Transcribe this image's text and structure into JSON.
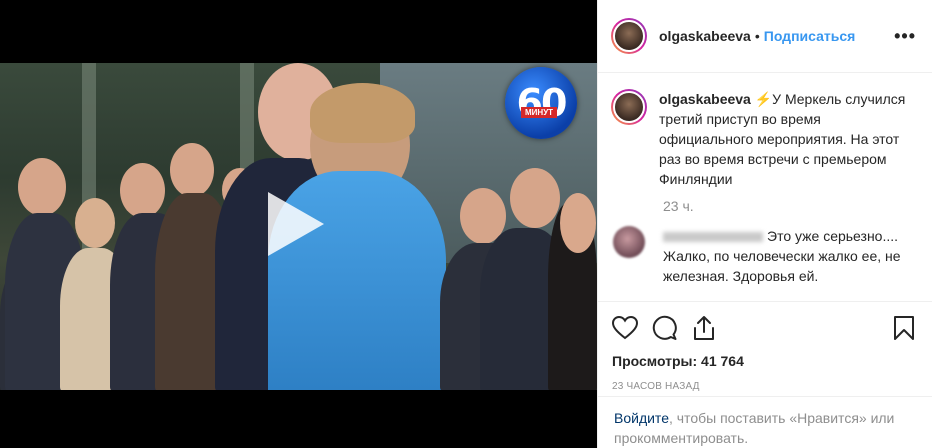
{
  "post": {
    "username": "olgaskabeeva",
    "separator": "•",
    "follow_label": "Подписаться",
    "more_label": "•••"
  },
  "caption": {
    "username": "olgaskabeeva",
    "emoji": "⚡",
    "text": "У Меркель случился третий приступ во время официального мероприятия. На этот раз во время встречи с премьером Финляндии",
    "time": "23 ч."
  },
  "comment": {
    "text": "Это уже серьезно.... Жалко, по человечески жалко ее, не железная. Здоровья ей."
  },
  "video": {
    "logo_number": "60",
    "logo_caption": "МИНУТ"
  },
  "stats": {
    "views": "Просмотры: 41 764",
    "ago": "23 ЧАСОВ НАЗАД"
  },
  "login": {
    "link": "Войдите",
    "rest": ", чтобы поставить «Нравится» или прокомментировать."
  },
  "icons": [
    "heart-icon",
    "comment-icon",
    "share-icon",
    "bookmark-icon",
    "play-icon"
  ]
}
